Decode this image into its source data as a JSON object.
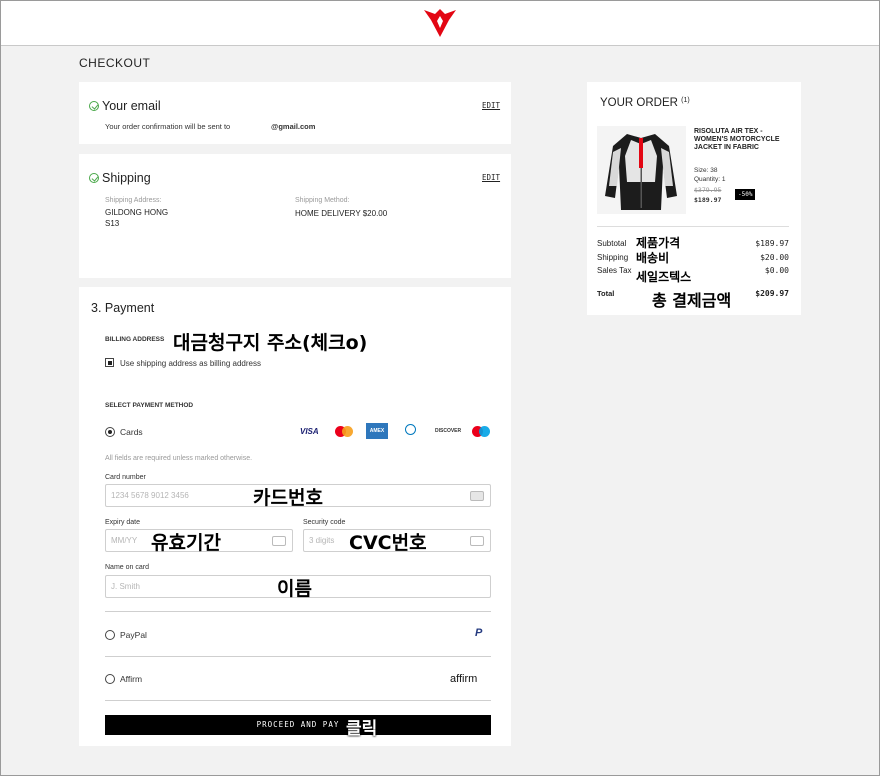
{
  "header": {
    "brand_logo": "dainese-logo"
  },
  "page_title": "CHECKOUT",
  "email_section": {
    "title": "Your email",
    "edit_label": "EDIT",
    "note": "Your order confirmation will be sent to",
    "email": "@gmail.com"
  },
  "shipping_section": {
    "title": "Shipping",
    "edit_label": "EDIT",
    "address_label": "Shipping Address:",
    "address_line1": "GILDONG HONG",
    "address_line2": "S13",
    "method_label": "Shipping Method:",
    "method_value": "HOME DELIVERY $20.00"
  },
  "payment_section": {
    "title": "3. Payment",
    "billing_label": "BILLING ADDRESS",
    "billing_annotation": "대금청구지 주소(체크o)",
    "billing_checkbox_label": "Use shipping address as billing address",
    "select_method_label": "SELECT PAYMENT METHOD",
    "cards_label": "Cards",
    "card_brands": [
      "VISA",
      "mastercard",
      "AMEX",
      "Diners Club",
      "DISCOVER",
      "maestro"
    ],
    "required_note": "All fields are required unless marked otherwise.",
    "card_number_label": "Card number",
    "card_number_placeholder": "1234 5678 9012 3456",
    "card_number_annotation": "카드번호",
    "expiry_label": "Expiry date",
    "expiry_placeholder": "MM/YY",
    "expiry_annotation": "유효기간",
    "security_label": "Security code",
    "security_placeholder": "3 digits",
    "security_annotation": "CVC번호",
    "name_label": "Name on card",
    "name_placeholder": "J. Smith",
    "name_annotation": "이름",
    "paypal_label": "PayPal",
    "paypal_logo": "P",
    "affirm_label": "Affirm",
    "affirm_logo": "affirm",
    "proceed_label": "PROCEED AND PAY",
    "proceed_annotation": "클릭"
  },
  "order": {
    "title": "YOUR ORDER",
    "count": "(1)",
    "product_name": "RISOLUTA AIR TEX - WOMEN'S MOTORCYCLE JACKET IN FABRIC",
    "size": "Size: 38",
    "quantity": "Quantity: 1",
    "old_price": "$379.95",
    "price": "$189.97",
    "discount": "-50%",
    "subtotal_label": "Subtotal",
    "subtotal_annotation": "제품가격",
    "subtotal_value": "$189.97",
    "shipping_label": "Shipping",
    "shipping_annotation": "배송비",
    "shipping_value": "$20.00",
    "tax_label": "Sales Tax",
    "tax_annotation": "세일즈텍스",
    "tax_value": "$0.00",
    "total_label": "Total",
    "total_annotation": "총 결제금액",
    "total_value": "$209.97"
  },
  "colors": {
    "logo_red": "#e30613",
    "check_green": "#4aa84a",
    "amex_blue": "#2e77bc"
  }
}
